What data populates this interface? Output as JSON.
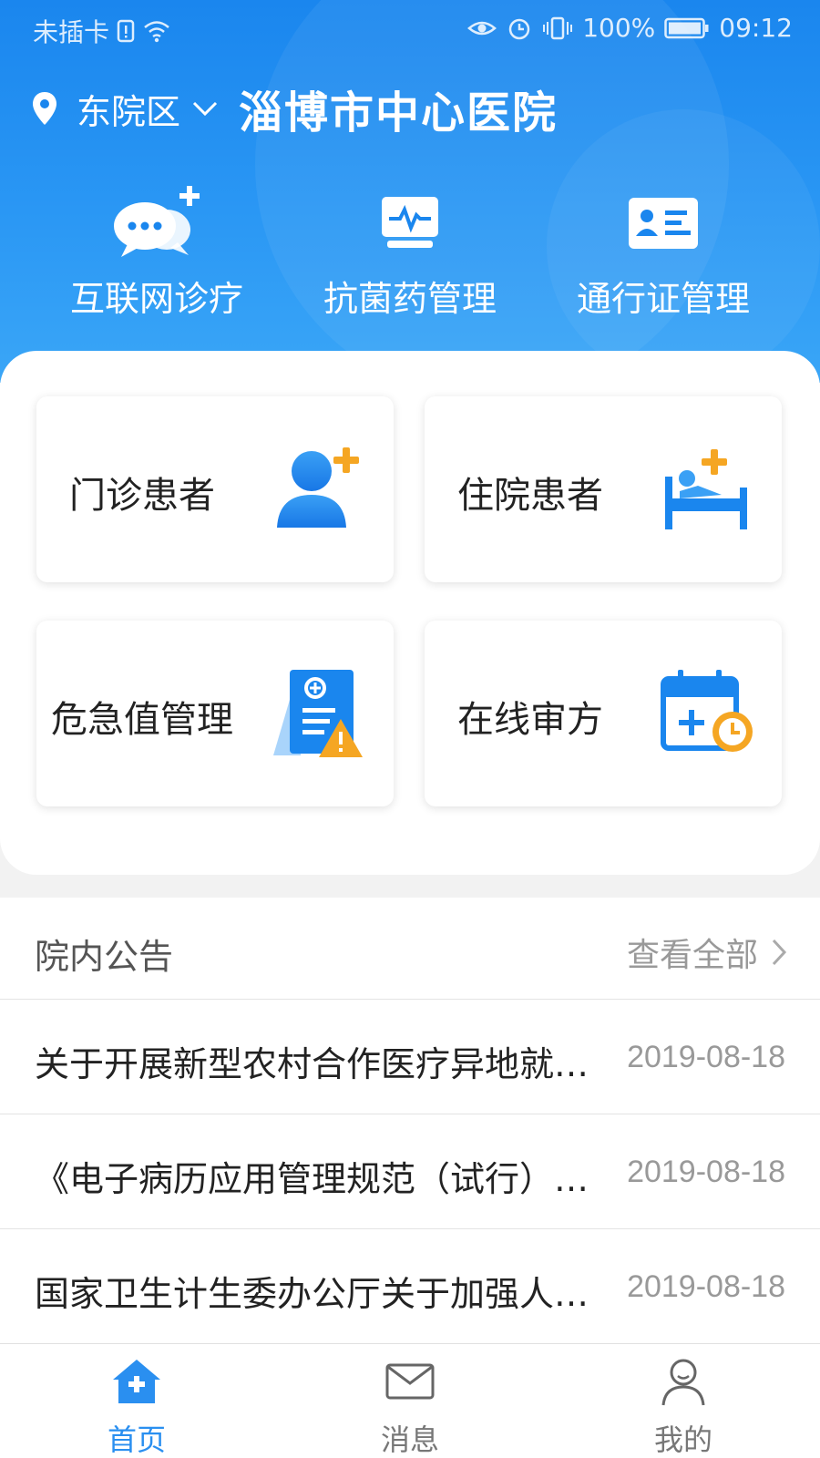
{
  "status_bar": {
    "carrier": "未插卡",
    "battery": "100%",
    "time": "09:12"
  },
  "header": {
    "campus": "东院区",
    "hospital_name": "淄博市中心医院"
  },
  "quick_actions": [
    {
      "label": "互联网诊疗",
      "icon": "chat-bubbles-plus-icon"
    },
    {
      "label": "抗菌药管理",
      "icon": "monitor-pulse-icon"
    },
    {
      "label": "通行证管理",
      "icon": "id-card-icon"
    }
  ],
  "tiles": [
    {
      "label": "门诊患者",
      "icon": "outpatient-add-icon"
    },
    {
      "label": "住院患者",
      "icon": "inpatient-bed-icon"
    },
    {
      "label": "危急值管理",
      "icon": "critical-document-warning-icon"
    },
    {
      "label": "在线审方",
      "icon": "calendar-add-clock-icon"
    }
  ],
  "notices": {
    "title": "院内公告",
    "view_all": "查看全部",
    "items": [
      {
        "text": "关于开展新型农村合作医疗异地就…",
        "date": "2019-08-18"
      },
      {
        "text": "《电子病历应用管理规范（试行）…",
        "date": "2019-08-18"
      },
      {
        "text": "国家卫生计生委办公厅关于加强人…",
        "date": "2019-08-18"
      }
    ]
  },
  "tabbar": [
    {
      "label": "首页",
      "icon": "home-icon",
      "active": true
    },
    {
      "label": "消息",
      "icon": "mail-icon",
      "active": false
    },
    {
      "label": "我的",
      "icon": "user-icon",
      "active": false
    }
  ],
  "colors": {
    "primary": "#1a86ee",
    "accent_orange": "#f5a623",
    "tab_active": "#2a8ff0",
    "tab_inactive": "#777777"
  }
}
